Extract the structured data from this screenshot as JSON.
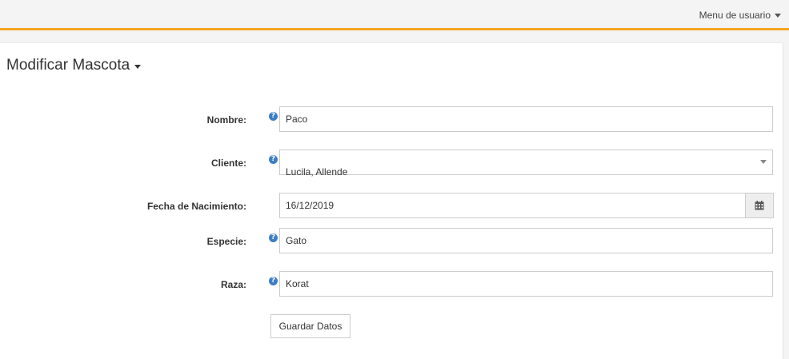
{
  "topbar": {
    "user_menu_label": "Menu de usuario",
    "accent_color": "#f5a623"
  },
  "page": {
    "title": "Modificar Mascota"
  },
  "form": {
    "nombre": {
      "label": "Nombre:",
      "value": "Paco"
    },
    "cliente": {
      "label": "Cliente:",
      "selected": "Lucila, Allende"
    },
    "fecha_nacimiento": {
      "label": "Fecha de Nacimiento:",
      "value": "16/12/2019"
    },
    "especie": {
      "label": "Especie:",
      "value": "Gato"
    },
    "raza": {
      "label": "Raza:",
      "value": "Korat"
    },
    "help_icon_glyph": "?",
    "save_label": "Guardar Datos"
  },
  "icons": {
    "help": "question-circle-icon",
    "calendar": "calendar-icon",
    "caret": "chevron-down-icon"
  }
}
